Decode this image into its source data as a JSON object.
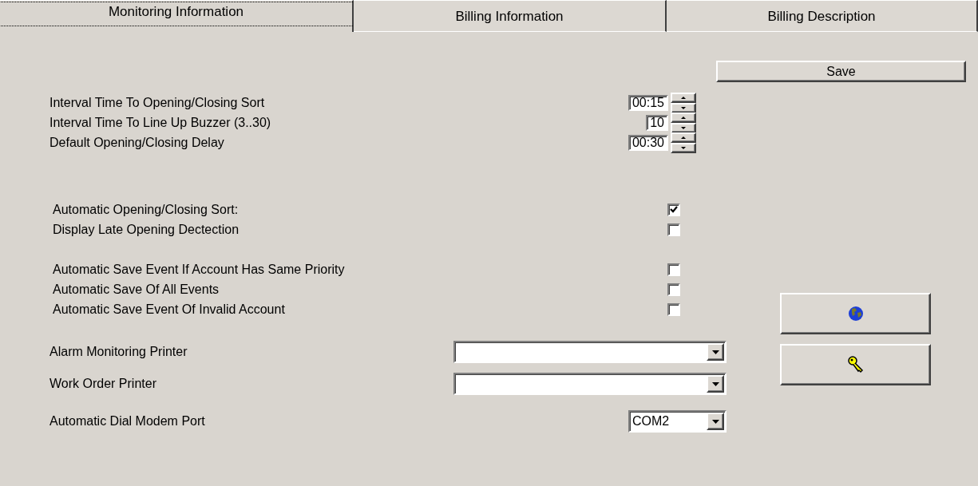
{
  "tabs": [
    {
      "label": "Monitoring Information",
      "selected": true
    },
    {
      "label": "Billing Information",
      "selected": false
    },
    {
      "label": "Billing Description",
      "selected": false
    }
  ],
  "save_button": "Save",
  "sections": [
    {
      "rows": [
        {
          "kind": "spinner",
          "label": "Interval Time To Opening/Closing Sort",
          "value": "00:15"
        },
        {
          "kind": "spinner",
          "label": "Interval Time To Line Up Buzzer (3..30)",
          "value": "10"
        },
        {
          "kind": "spinner",
          "label": "Default Opening/Closing Delay",
          "value": "00:30"
        }
      ]
    },
    {
      "rows": [
        {
          "kind": "checkbox",
          "label": "Automatic Opening/Closing Sort:",
          "checked": true
        },
        {
          "kind": "checkbox",
          "label": "Display Late Opening Dectection",
          "checked": false
        }
      ]
    },
    {
      "rows": [
        {
          "kind": "checkbox",
          "label": "Automatic Save Event If Account Has Same Priority",
          "checked": false
        },
        {
          "kind": "checkbox",
          "label": "Automatic Save Of All Events",
          "checked": false
        },
        {
          "kind": "checkbox",
          "label": "Automatic Save Event Of Invalid Account",
          "checked": false
        }
      ]
    },
    {
      "rows": [
        {
          "kind": "dropdown",
          "label": "Alarm Monitoring Printer"
        },
        {
          "kind": "dropdown",
          "label": "Work Order Printer"
        }
      ]
    },
    {
      "rows": [
        {
          "kind": "dropdown-small",
          "label": "Automatic Dial Modem Port",
          "value": "COM2"
        }
      ]
    }
  ]
}
